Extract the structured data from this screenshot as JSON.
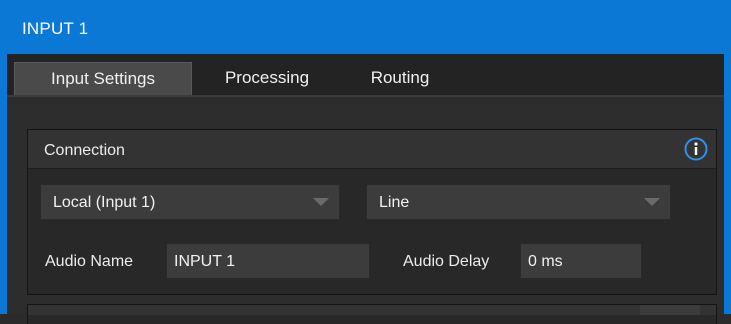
{
  "window": {
    "title": "INPUT 1",
    "accent_color": "#0b78d6"
  },
  "tabs": [
    {
      "label": "Input Settings",
      "active": true
    },
    {
      "label": "Processing",
      "active": false
    },
    {
      "label": "Routing",
      "active": false
    }
  ],
  "connection": {
    "title": "Connection",
    "info_icon": "info-icon",
    "source_dropdown": {
      "selected": "Local (Input 1)"
    },
    "level_dropdown": {
      "selected": "Line"
    },
    "audio_name": {
      "label": "Audio Name",
      "value": "INPUT 1"
    },
    "audio_delay": {
      "label": "Audio Delay",
      "value": "0 ms"
    }
  }
}
